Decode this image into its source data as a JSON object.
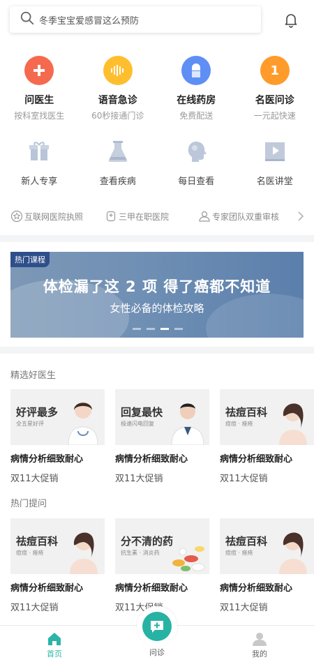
{
  "search": {
    "placeholder": "冬季宝宝爱感冒这么预防"
  },
  "services": [
    {
      "title": "问医生",
      "subtitle": "按科室找医生",
      "color": "#f56a4f",
      "icon": "plus-icon"
    },
    {
      "title": "语音急诊",
      "subtitle": "60秒接通门诊",
      "color": "#ffbe2e",
      "icon": "voice-icon"
    },
    {
      "title": "在线药房",
      "subtitle": "免费配送",
      "color": "#5f8ff5",
      "icon": "pill-icon"
    },
    {
      "title": "名医问诊",
      "subtitle": "一元起快速",
      "color": "#ff9b2b",
      "icon": "number-one-icon",
      "glyph": "1"
    }
  ],
  "quick_links": [
    {
      "label": "新人专享",
      "icon": "gift-icon"
    },
    {
      "label": "查看疾病",
      "icon": "flask-icon"
    },
    {
      "label": "每日查看",
      "icon": "head-icon"
    },
    {
      "label": "名医讲堂",
      "icon": "video-icon"
    }
  ],
  "trust": [
    {
      "label": "互联网医院执照",
      "icon": "badge-icon"
    },
    {
      "label": "三甲在职医院",
      "icon": "hospital-icon"
    },
    {
      "label": "专家团队双重审核",
      "icon": "user-icon"
    }
  ],
  "banner": {
    "tag": "热门课程",
    "headline": "体检漏了这 2 项 得了癌都不知道",
    "subheadline": "女性必备的体检攻略",
    "slides": 4,
    "active_slide": 3
  },
  "featured_doctors": {
    "title": "精选好医生",
    "cards": [
      {
        "img_title": "好评最多",
        "img_sub": "全五星好评",
        "name": "病情分析细致耐心",
        "promo": "双11大促销"
      },
      {
        "img_title": "回复最快",
        "img_sub": "极速闪电回复",
        "name": "病情分析细致耐心",
        "promo": "双11大促销"
      },
      {
        "img_title": "祛痘百科",
        "img_sub": "痘痘 · 痤疮",
        "name": "病情分析细致耐心",
        "promo": "双11大促销"
      }
    ]
  },
  "hot_questions": {
    "title": "热门提问",
    "cards": [
      {
        "img_title": "祛痘百科",
        "img_sub": "痘痘 · 痤疮",
        "name": "病情分析细致耐心",
        "promo": "双11大促销"
      },
      {
        "img_title": "分不清的药",
        "img_sub": "抗生素 · 消炎药",
        "name": "病情分析细致耐心",
        "promo": "双11大促销"
      },
      {
        "img_title": "祛痘百科",
        "img_sub": "痘痘 · 痤疮",
        "name": "病情分析细致耐心",
        "promo": "双11大促销"
      }
    ]
  },
  "tabbar": {
    "home": "首页",
    "consult": "问诊",
    "me": "我的",
    "accent": "#2bb5a7"
  }
}
